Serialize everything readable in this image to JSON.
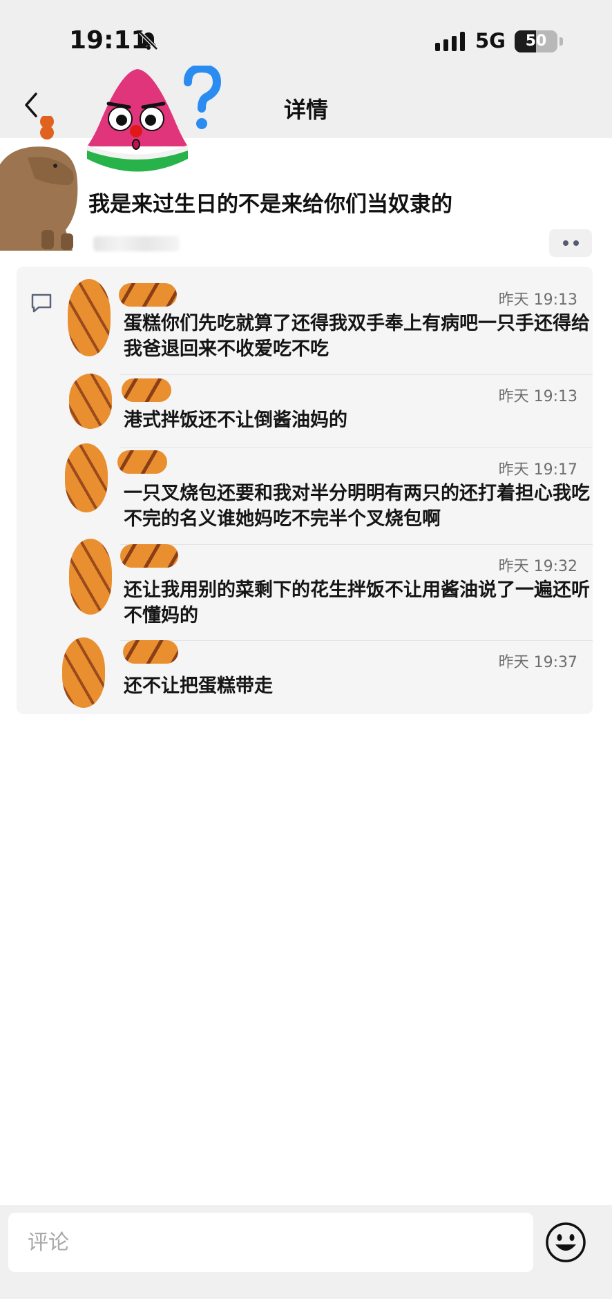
{
  "status_bar": {
    "time": "19:11",
    "network": "5G",
    "battery": "50",
    "battery_level": 0.5
  },
  "nav": {
    "title": "详情"
  },
  "post": {
    "text": "我是来过生日的不是来给你们当奴隶的"
  },
  "comments": [
    {
      "time": "昨天 19:13",
      "text": "蛋糕你们先吃就算了还得我双手奉上有病吧一只手还得给我爸退回来不收爱吃不吃"
    },
    {
      "time": "昨天 19:13",
      "text": "港式拌饭还不让倒酱油妈的"
    },
    {
      "time": "昨天 19:17",
      "text": "一只叉烧包还要和我对半分明明有两只的还打着担心我吃不完的名义谁她妈吃不完半个叉烧包啊"
    },
    {
      "time": "昨天 19:32",
      "text": "还让我用别的菜剩下的花生拌饭不让用酱油说了一遍还听不懂妈的"
    },
    {
      "time": "昨天 19:37",
      "text": "还不让把蛋糕带走"
    }
  ],
  "input": {
    "placeholder": "评论"
  },
  "colors": {
    "accent_orange": "#e98f2f",
    "panel": "#f5f5f5",
    "icon_blue_grey": "#545c70"
  }
}
